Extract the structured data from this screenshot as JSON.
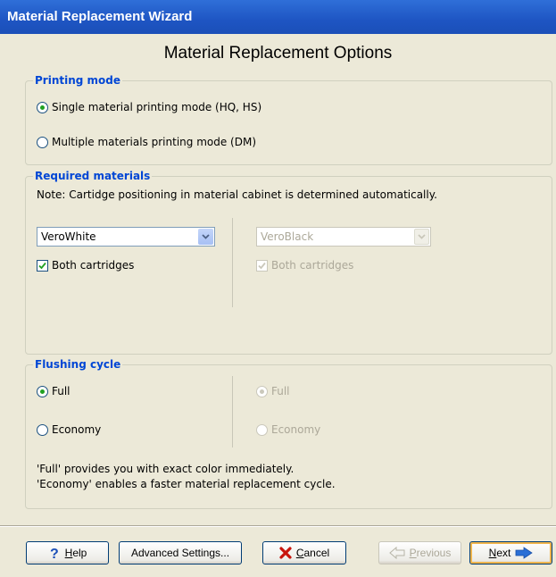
{
  "window": {
    "title": "Material Replacement Wizard"
  },
  "heading": "Material Replacement Options",
  "printing_mode": {
    "legend": "Printing mode",
    "options": [
      {
        "label": "Single material printing mode (HQ, HS)",
        "checked": true
      },
      {
        "label": "Multiple materials printing mode (DM)",
        "checked": false
      }
    ]
  },
  "required_materials": {
    "legend": "Required materials",
    "note": "Note: Cartidge positioning in material cabinet is determined automatically.",
    "left": {
      "material": "VeroWhite",
      "both_label": "Both cartridges",
      "both_checked": true
    },
    "right": {
      "material": "VeroBlack",
      "both_label": "Both cartridges",
      "both_checked": true,
      "enabled": false
    }
  },
  "flushing_cycle": {
    "legend": "Flushing cycle",
    "left": {
      "full": "Full",
      "economy": "Economy",
      "selected": "Full"
    },
    "right": {
      "full": "Full",
      "economy": "Economy",
      "selected": "Full",
      "enabled": false
    },
    "info_line1": "'Full' provides you with exact color immediately.",
    "info_line2": "'Economy' enables a faster material replacement cycle."
  },
  "buttons": {
    "help": "Help",
    "help_mnemonic": "H",
    "help_rest": "elp",
    "advanced": "Advanced Settings...",
    "cancel_mnemonic": "C",
    "cancel_rest": "ancel",
    "previous_mnemonic": "P",
    "previous_rest": "revious",
    "next_mnemonic": "N",
    "next_rest": "ext"
  },
  "colors": {
    "title_bar": "#1e55c3",
    "legend": "#0046d5",
    "default_button_focus": "#f0b54c"
  }
}
